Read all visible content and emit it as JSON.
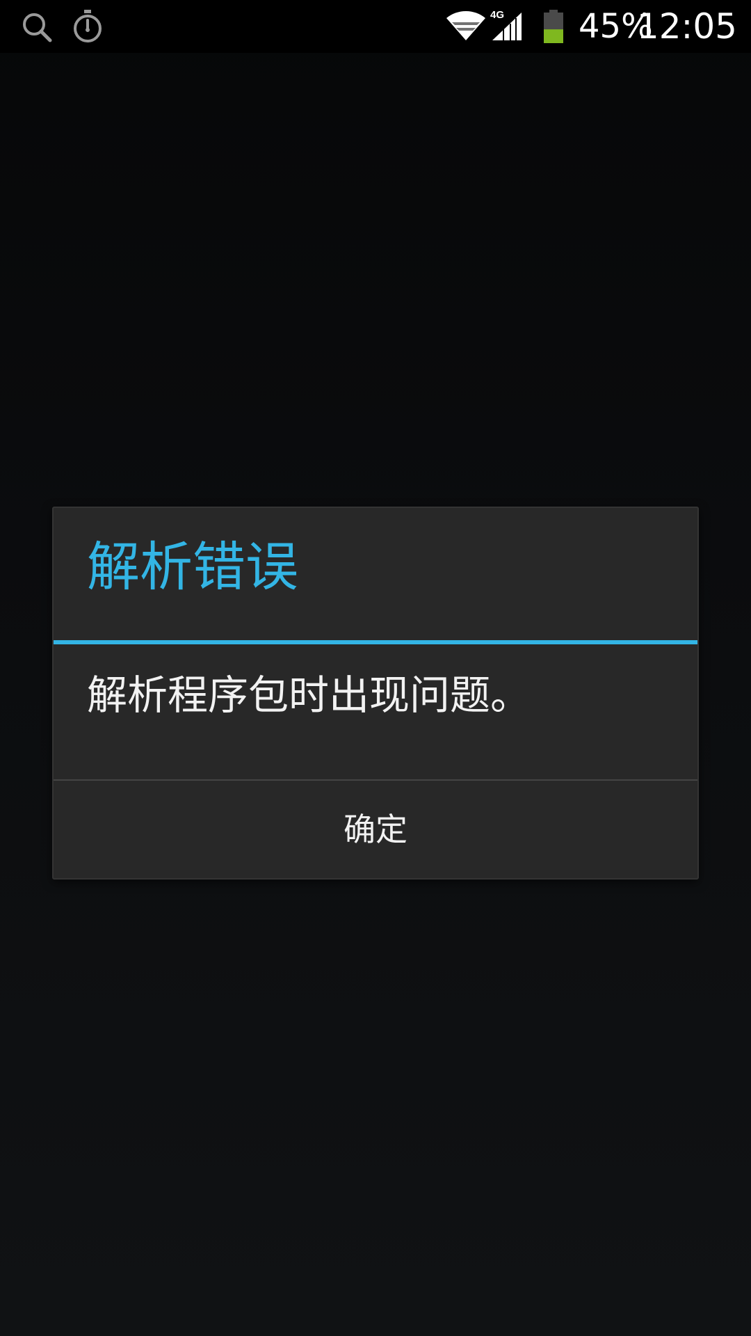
{
  "status_bar": {
    "left_icons": [
      "search-icon",
      "stopwatch-icon"
    ],
    "right_icons": [
      "wifi-icon",
      "signal-4g-icon",
      "battery-icon"
    ],
    "network_type": "4G",
    "battery_percent": "45%",
    "battery_level": 0.45,
    "battery_color": "#7fb81f",
    "time": "12:05"
  },
  "dialog": {
    "title": "解析错误",
    "message": "解析程序包时出现问题。",
    "ok_label": "确定",
    "accent_color": "#33b5e5"
  }
}
